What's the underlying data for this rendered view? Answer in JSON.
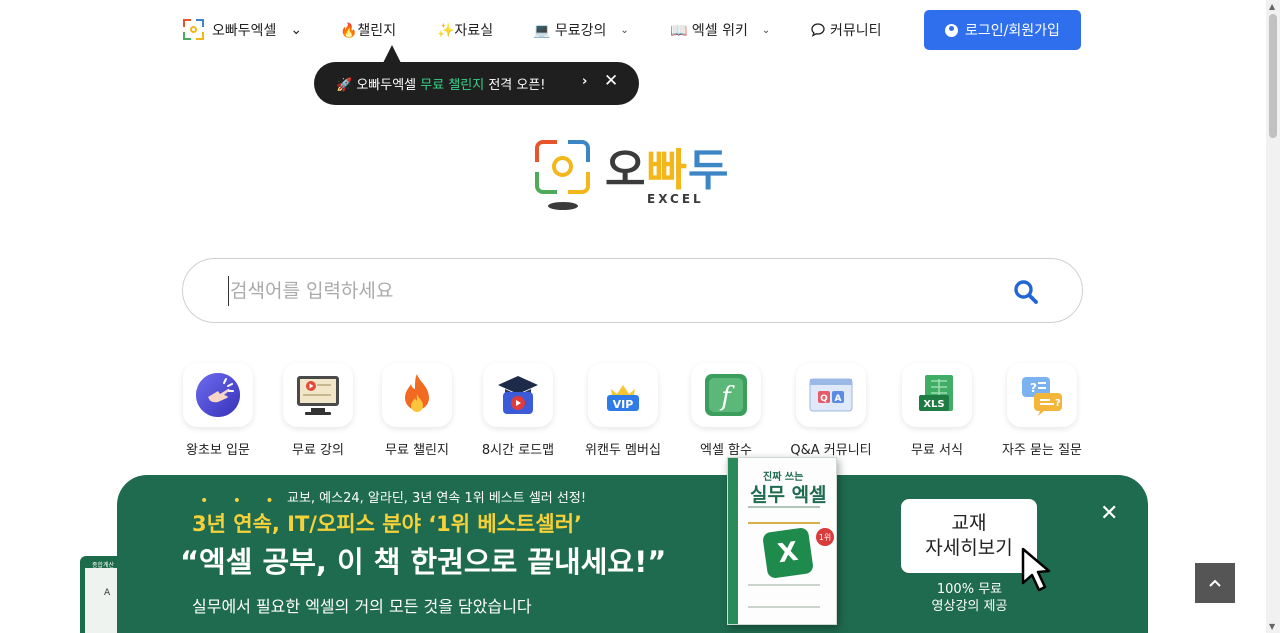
{
  "nav": {
    "brand": "오빠두엑셀",
    "challenge": "🔥챌린지",
    "resources": "✨자료실",
    "free_courses": "💻 무료강의",
    "excel_wiki": "📖 엑셀 위키",
    "community": "커뮤니티",
    "login": "로그인/회원가입"
  },
  "toast": {
    "prefix": "🚀 오빠두엑셀 ",
    "highlight": "무료 챌린지",
    "suffix": " 전격 오픈!",
    "go": "›",
    "close": "✕"
  },
  "logo": {
    "title_o": "오",
    "title_b": "빠",
    "title_d": "두",
    "subtitle": "EXCEL"
  },
  "search": {
    "placeholder": "검색어를 입력하세요"
  },
  "categories": [
    {
      "label": "왕초보 입문",
      "icon": "pointing-hand-icon"
    },
    {
      "label": "무료 강의",
      "icon": "monitor-video-icon"
    },
    {
      "label": "무료 챌린지",
      "icon": "fire-icon"
    },
    {
      "label": "8시간 로드맵",
      "icon": "graduation-play-icon"
    },
    {
      "label": "위캔두 멤버십",
      "icon": "vip-crown-icon"
    },
    {
      "label": "엑셀 함수",
      "icon": "function-icon"
    },
    {
      "label": "Q&A 커뮤니티",
      "icon": "qa-window-icon"
    },
    {
      "label": "무료 서식",
      "icon": "xls-file-icon"
    },
    {
      "label": "자주 묻는 질문",
      "icon": "faq-chat-icon"
    }
  ],
  "banner": {
    "line1": "교보, 예스24, 알라딘, 3년 연속 1위 베스트 셀러 선정!",
    "line2": "3년 연속, IT/오피스 분야 ‘1위 베스트셀러’",
    "line3": "“엑셀 공부, 이 책 한권으로 끝내세요!”",
    "line4": "실무에서 필요한 엑셀의 거의 모든 것을 담았습니다",
    "book_top": "진짜 쓰는",
    "book_title": "실무 엑셀",
    "book_badge": "1위",
    "book_x": "X",
    "detail_btn_line1": "교재",
    "detail_btn_line2": "자세히보기",
    "free_line1": "100% 무료",
    "free_line2": "영상강의 제공",
    "close": "✕",
    "side_label": "종합계산",
    "side_cell": "A"
  },
  "to_top": "⌃",
  "colors": {
    "accent": "#2f6fed",
    "banner_bg": "#1f6b4f",
    "highlight_green": "#35d38b",
    "banner_yellow": "#f5d13a"
  }
}
